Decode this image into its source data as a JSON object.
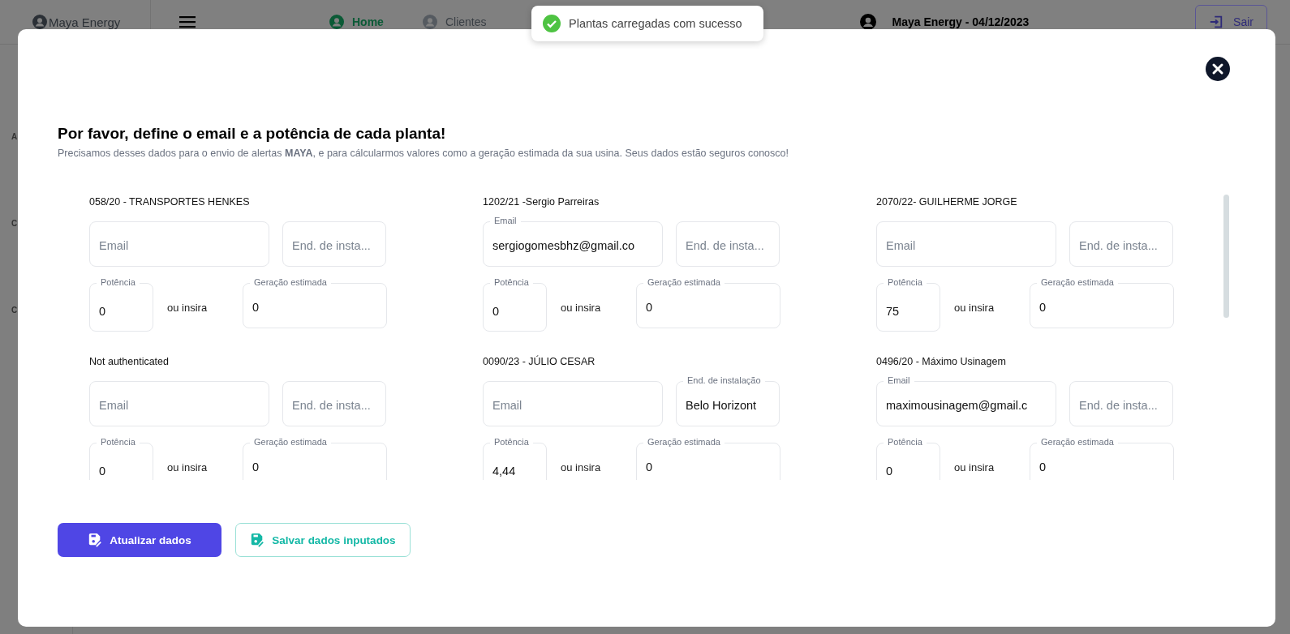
{
  "navbar": {
    "brand": "Maya Energy",
    "nav_items": [
      {
        "label": "Home",
        "selected": true
      },
      {
        "label": "Clientes",
        "selected": false
      }
    ],
    "user": "Maya Energy - 04/12/2023",
    "logout": "Sair"
  },
  "sidebar_fragments": [
    "A",
    "C",
    "C"
  ],
  "toast": {
    "message": "Plantas carregadas com sucesso"
  },
  "modal": {
    "title": "Por favor, define o email e a potência de cada planta!",
    "subtitle": "Precisamos desses dados para o envio de alertas **MAYA**, e para cálcularmos valores como a geração estimada da sua usina. Seus dados estão seguros conosco!",
    "plants": [
      {
        "name": "058/20 - TRANSPORTES HENKES",
        "email": {
          "placeholder": "Email"
        },
        "address": {
          "placeholder": "End. de insta..."
        },
        "power": {
          "label": "Potência",
          "value": "0"
        },
        "or_text": "ou insira",
        "generation": {
          "label": "Geração estimada",
          "value": "0"
        }
      },
      {
        "name": "1202/21 -Sergio Parreiras",
        "email": {
          "label": "Email",
          "value": "sergiogomesbhz@gmail.co"
        },
        "address": {
          "placeholder": "End. de insta..."
        },
        "power": {
          "label": "Potência",
          "value": "0"
        },
        "or_text": "ou insira",
        "generation": {
          "label": "Geração estimada",
          "value": "0"
        }
      },
      {
        "name": "2070/22- GUILHERME JORGE",
        "email": {
          "placeholder": "Email"
        },
        "address": {
          "placeholder": "End. de insta..."
        },
        "power": {
          "label": "Potência",
          "value": "75"
        },
        "or_text": "ou insira",
        "generation": {
          "label": "Geração estimada",
          "value": "0"
        }
      },
      {
        "name": "Not authenticated",
        "email": {
          "placeholder": "Email"
        },
        "address": {
          "placeholder": "End. de insta..."
        },
        "power": {
          "label": "Potência",
          "value": "0"
        },
        "or_text": "ou insira",
        "generation": {
          "label": "Geração estimada",
          "value": "0"
        }
      },
      {
        "name": "0090/23 - JÚLIO CESAR",
        "email": {
          "placeholder": "Email"
        },
        "address": {
          "label": "End. de instalação",
          "value": "Belo Horizont"
        },
        "power": {
          "label": "Potência",
          "value": "4,44"
        },
        "or_text": "ou insira",
        "generation": {
          "label": "Geração estimada",
          "value": "0"
        }
      },
      {
        "name": "0496/20 - Máximo Usinagem",
        "email": {
          "label": "Email",
          "value": "maximousinagem@gmail.c"
        },
        "address": {
          "placeholder": "End. de insta..."
        },
        "power": {
          "label": "Potência",
          "value": "0"
        },
        "or_text": "ou insira",
        "generation": {
          "label": "Geração estimada",
          "value": "0"
        }
      }
    ],
    "buttons": [
      {
        "label": "Atualizar dados",
        "kind": "primary"
      },
      {
        "label": "Salvar dados inputados",
        "kind": "outline"
      }
    ]
  }
}
